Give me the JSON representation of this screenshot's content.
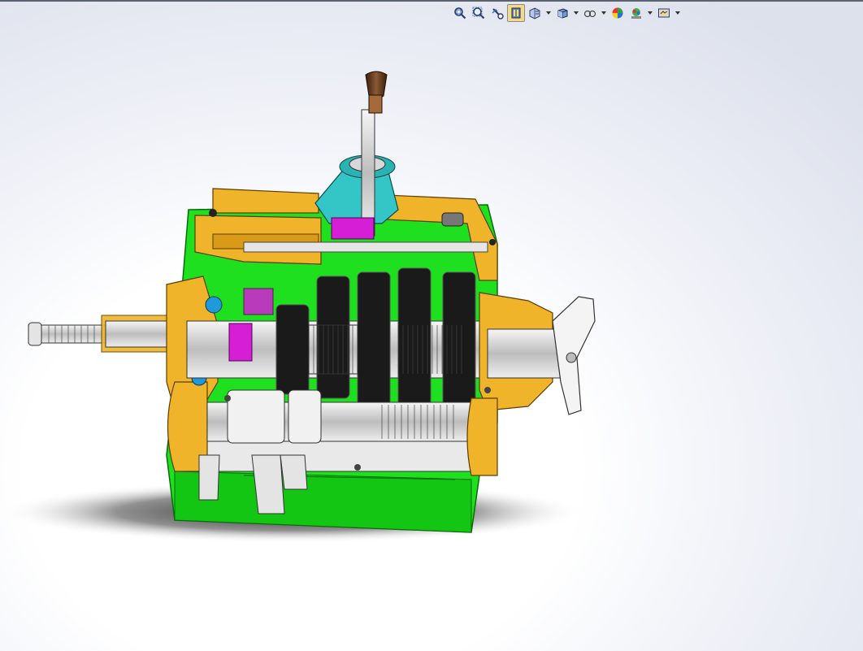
{
  "app": {
    "name": "CAD viewport"
  },
  "toolbar": {
    "items": [
      {
        "icon": "zoom-to-fit-icon",
        "active": false
      },
      {
        "icon": "zoom-to-area-icon",
        "active": false
      },
      {
        "icon": "previous-view-icon",
        "active": false
      },
      {
        "icon": "section-view-icon",
        "active": true
      },
      {
        "icon": "dynamic-annotation-icon",
        "active": false,
        "dropdown": true
      },
      {
        "icon": "view-orientation-icon",
        "active": false,
        "dropdown": true
      },
      {
        "icon": "display-style-icon",
        "active": false,
        "dropdown": true
      },
      {
        "icon": "hide-show-items-icon",
        "active": false,
        "dropdown": true
      },
      {
        "icon": "edit-appearance-icon",
        "active": false
      },
      {
        "icon": "apply-scene-icon",
        "active": false,
        "dropdown": true
      },
      {
        "icon": "view-settings-icon",
        "active": false,
        "dropdown": true
      }
    ]
  },
  "model": {
    "description": "gearbox-section-view",
    "colors": {
      "housing": "#1fe01f",
      "cover": "#f0b42a",
      "bearing_caps": "#1e9ad8",
      "synchro": "#d51ed6",
      "shift_boot": "#34c6c6",
      "knob": "#5a3218",
      "gears": "#1a1a1a",
      "shafts": "#d9d9d9",
      "background": "#ffffff"
    }
  }
}
